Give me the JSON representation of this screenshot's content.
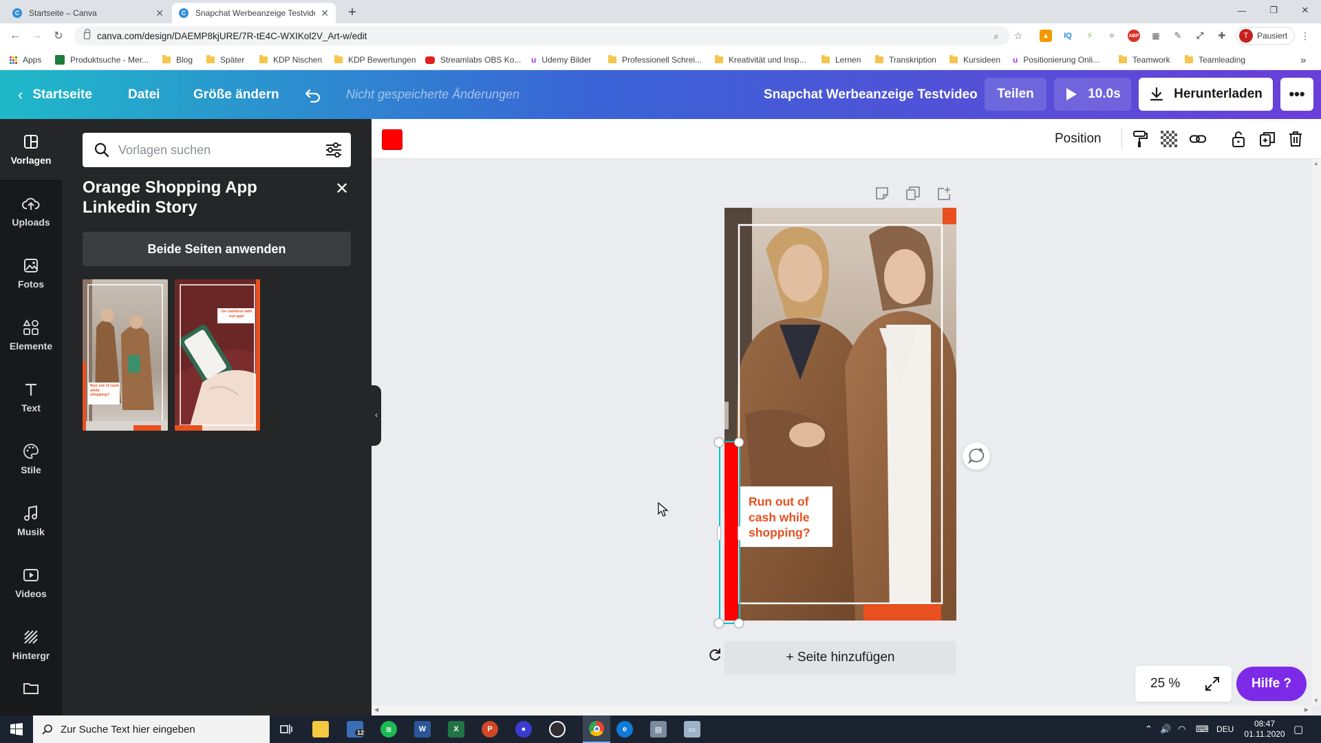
{
  "browser": {
    "tabs": [
      {
        "title": "Startseite – Canva",
        "favicon": "canva-favicon",
        "active": false
      },
      {
        "title": "Snapchat Werbeanzeige Testvide",
        "favicon": "canva-favicon",
        "active": true
      }
    ],
    "url": "canva.com/design/DAEMP8kjURE/7R-tE4C-WXIKol2V_Art-w/edit",
    "profile_label": "Pausiert",
    "profile_initial": "T",
    "bookmarks": [
      {
        "label": "Apps",
        "icon": "apps-grid-icon"
      },
      {
        "label": "Produktsuche - Mer...",
        "icon": "merch-favicon"
      },
      {
        "label": "Blog",
        "icon": "folder-icon"
      },
      {
        "label": "Später",
        "icon": "folder-icon"
      },
      {
        "label": "KDP Nischen",
        "icon": "folder-icon"
      },
      {
        "label": "KDP Bewertungen",
        "icon": "folder-icon"
      },
      {
        "label": "Streamlabs OBS Ko...",
        "icon": "youtube-favicon"
      },
      {
        "label": "Udemy Bilder",
        "icon": "udemy-favicon"
      },
      {
        "label": "Professionell Schrei...",
        "icon": "folder-icon"
      },
      {
        "label": "Kreativität und Insp...",
        "icon": "folder-icon"
      },
      {
        "label": "Lernen",
        "icon": "folder-icon"
      },
      {
        "label": "Transkription",
        "icon": "folder-icon"
      },
      {
        "label": "Kursideen",
        "icon": "folder-icon"
      },
      {
        "label": "Positionierung Onli...",
        "icon": "udemy-favicon"
      },
      {
        "label": "Teamwork",
        "icon": "folder-icon"
      },
      {
        "label": "Teamleading",
        "icon": "folder-icon"
      }
    ],
    "bookmarks_overflow": "»"
  },
  "canva_header": {
    "back_label": "Startseite",
    "file_label": "Datei",
    "resize_label": "Größe ändern",
    "unsaved_label": "Nicht gespeicherte Änderungen",
    "design_title": "Snapchat Werbeanzeige Testvideo",
    "share_label": "Teilen",
    "play_label": "10.0s",
    "download_label": "Herunterladen",
    "more_label": "•••"
  },
  "sidebar": {
    "items": [
      {
        "label": "Vorlagen",
        "icon": "templates-icon",
        "active": true
      },
      {
        "label": "Uploads",
        "icon": "upload-cloud-icon",
        "active": false
      },
      {
        "label": "Fotos",
        "icon": "photo-icon",
        "active": false
      },
      {
        "label": "Elemente",
        "icon": "shapes-icon",
        "active": false
      },
      {
        "label": "Text",
        "icon": "text-t-icon",
        "active": false
      },
      {
        "label": "Stile",
        "icon": "palette-icon",
        "active": false
      },
      {
        "label": "Musik",
        "icon": "music-note-icon",
        "active": false
      },
      {
        "label": "Videos",
        "icon": "video-icon",
        "active": false
      },
      {
        "label": "Hintergr",
        "icon": "background-pattern-icon",
        "active": false
      }
    ]
  },
  "panel": {
    "search_placeholder": "Vorlagen suchen",
    "template_title": "Orange Shopping App Linkedin Story",
    "apply_label": "Beide Seiten anwenden",
    "thumb1_caption": "Run out of cash while shopping?",
    "thumb2_caption": "Go cashless with our app!"
  },
  "toolbar": {
    "color": "#FF0000",
    "position_label": "Position"
  },
  "canvas": {
    "textbox_text": "Run out of cash while shopping?",
    "add_page_label": "+ Seite hinzufügen",
    "zoom_label": "25 %",
    "help_label": "Hilfe ?"
  },
  "taskbar": {
    "search_placeholder": "Zur Suche Text hier eingeben",
    "mail_badge": "12",
    "language": "DEU",
    "time": "08:47",
    "date": "01.11.2020"
  },
  "colors": {
    "canva_gradient_start": "#1fb9c9",
    "canva_gradient_end": "#6a3fd9",
    "accent_orange": "#e8501f",
    "selection_cyan": "#00c4cc",
    "help_purple": "#7d2ae8"
  }
}
